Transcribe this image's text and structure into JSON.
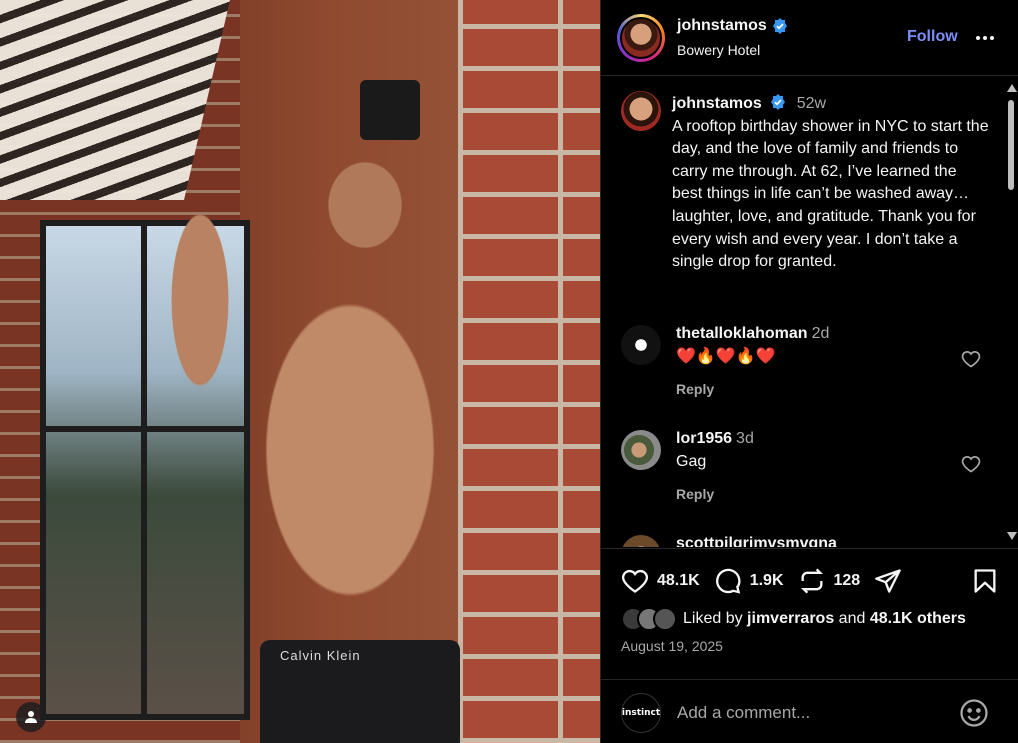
{
  "post": {
    "username": "johnstamos",
    "location": "Bowery Hotel",
    "follow_label": "Follow",
    "photo_brand_text": "Calvin Klein"
  },
  "caption": {
    "username": "johnstamos",
    "time": "52w",
    "text": "A rooftop birthday shower in NYC to start the day, and the love of family and friends to carry me through. At 62, I’ve learned the best things in life can’t be washed away…laughter, love, and gratitude. Thank you for every wish and every year. I don’t take a single drop for granted."
  },
  "comments": [
    {
      "username": "thetalloklahoman",
      "time": "2d",
      "text": "❤️🔥❤️🔥❤️",
      "reply_label": "Reply"
    },
    {
      "username": "lor1956",
      "time": "3d",
      "text": "Gag",
      "reply_label": "Reply"
    },
    {
      "username": "scottpilgrimvsmvgna",
      "time": "",
      "text": "",
      "reply_label": ""
    }
  ],
  "actions": {
    "likes": "48.1K",
    "comments": "1.9K",
    "reposts": "128"
  },
  "liked_by": {
    "prefix": "Liked by",
    "user": "jimverraros",
    "conj": "and",
    "others": "48.1K others"
  },
  "date": "August 19, 2025",
  "add_comment": {
    "avatar_text": "instinct",
    "placeholder": "Add a comment..."
  },
  "colors": {
    "follow": "#7b8ef8",
    "verified": "#3897f0",
    "secondary_text": "#a8a8a8",
    "panel_bg": "#000000"
  },
  "icons": [
    "verified-badge-icon",
    "more-icon",
    "heart-icon",
    "comment-icon",
    "repost-icon",
    "share-icon",
    "save-icon",
    "emoji-icon",
    "user-tag-icon"
  ]
}
